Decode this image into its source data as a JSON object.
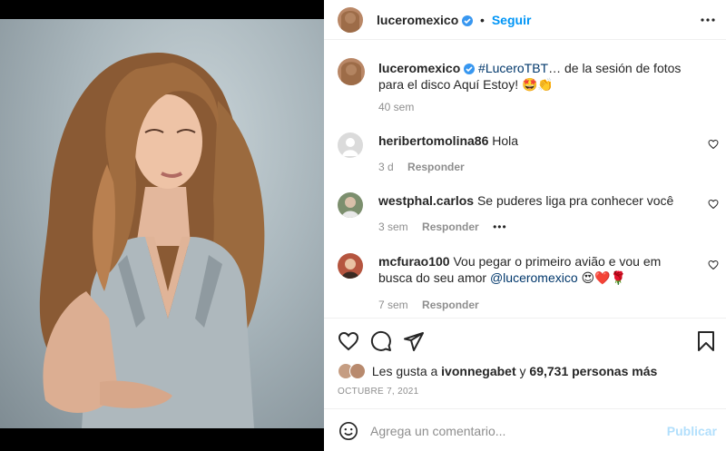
{
  "post": {
    "author": "luceromexico",
    "follow_label": "Seguir",
    "dot": "•",
    "caption_hashtag": "#LuceroTBT",
    "caption_text": "… de la sesión de fotos para el disco Aquí Estoy! 🤩👏",
    "caption_time": "40 sem"
  },
  "comments": [
    {
      "user": "heribertomolina86",
      "text": "Hola",
      "time": "3 d",
      "reply": "Responder"
    },
    {
      "user": "westphal.carlos",
      "text": "Se puderes liga pra conhecer você",
      "time": "3 sem",
      "reply": "Responder",
      "more": "•••"
    },
    {
      "user": "mcfurao100",
      "text": "Vou pegar o primeiro avião e vou em busca do seu amor",
      "mention": "@luceromexico",
      "emoji": "😍❤️🌹",
      "time": "7 sem",
      "reply": "Responder"
    }
  ],
  "likes": {
    "prefix": "Les gusta a",
    "user": "ivonnegabet",
    "joiner": "y",
    "count": "69,731 personas más"
  },
  "date": "OCTUBRE 7, 2021",
  "composer": {
    "placeholder": "Agrega un comentario...",
    "publish": "Publicar"
  },
  "colors": {
    "accent": "#0095f6",
    "link": "#00376b",
    "muted": "#8e8e8e",
    "border": "#efefef",
    "verified": "#3897f0"
  },
  "icons": [
    "heart-icon",
    "comment-icon",
    "share-icon",
    "bookmark-icon",
    "more-icon",
    "emoji-icon",
    "verified-icon"
  ]
}
